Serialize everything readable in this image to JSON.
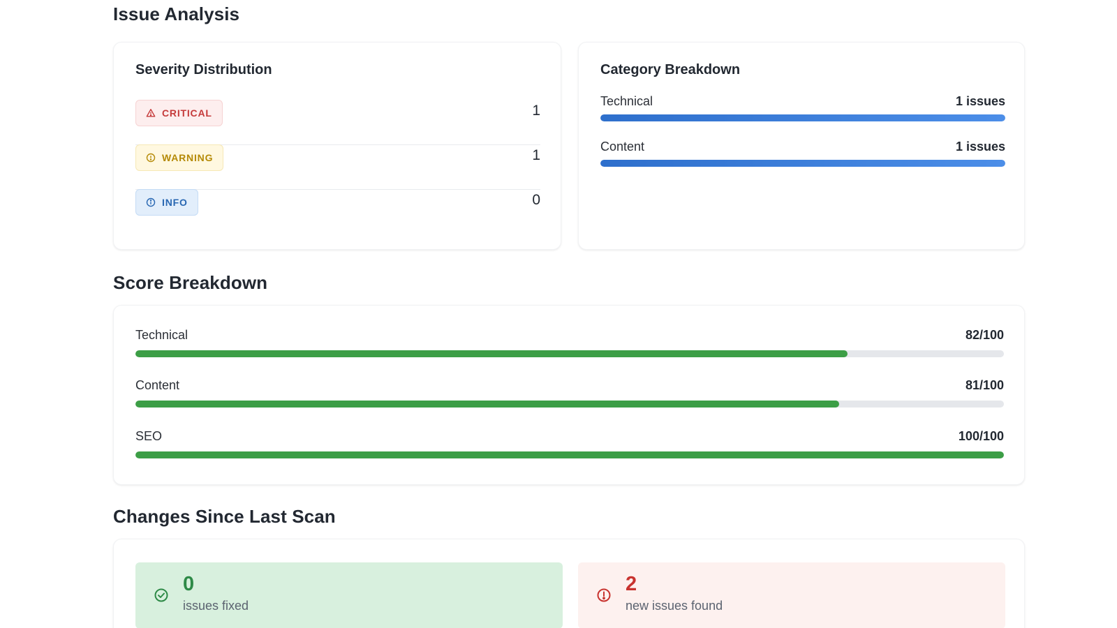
{
  "sections": {
    "issue_analysis": "Issue Analysis",
    "score_breakdown": "Score Breakdown",
    "changes": "Changes Since Last Scan"
  },
  "severity": {
    "title": "Severity Distribution",
    "items": [
      {
        "label": "CRITICAL",
        "count": "1",
        "icon": "warning-triangle-icon",
        "color": "#c53a3a"
      },
      {
        "label": "WARNING",
        "count": "1",
        "icon": "alert-circle-icon",
        "color": "#b58a07"
      },
      {
        "label": "INFO",
        "count": "0",
        "icon": "info-circle-icon",
        "color": "#2867b2"
      }
    ]
  },
  "category": {
    "title": "Category Breakdown",
    "items": [
      {
        "label": "Technical",
        "value": "1 issues",
        "fraction": 1.0
      },
      {
        "label": "Content",
        "value": "1 issues",
        "fraction": 1.0
      }
    ],
    "bar_color": "#2e6fcc"
  },
  "scores": {
    "items": [
      {
        "label": "Technical",
        "value": "82/100",
        "score": 82
      },
      {
        "label": "Content",
        "value": "81/100",
        "score": 81
      },
      {
        "label": "SEO",
        "value": "100/100",
        "score": 100
      }
    ],
    "bar_color": "#3c9e46"
  },
  "changes": {
    "fixed": {
      "count": "0",
      "text": "issues fixed",
      "icon": "check-circle-icon",
      "color": "#2e8a47"
    },
    "new": {
      "count": "2",
      "text": "new issues found",
      "icon": "alert-circle-icon",
      "color": "#c8332f"
    }
  }
}
